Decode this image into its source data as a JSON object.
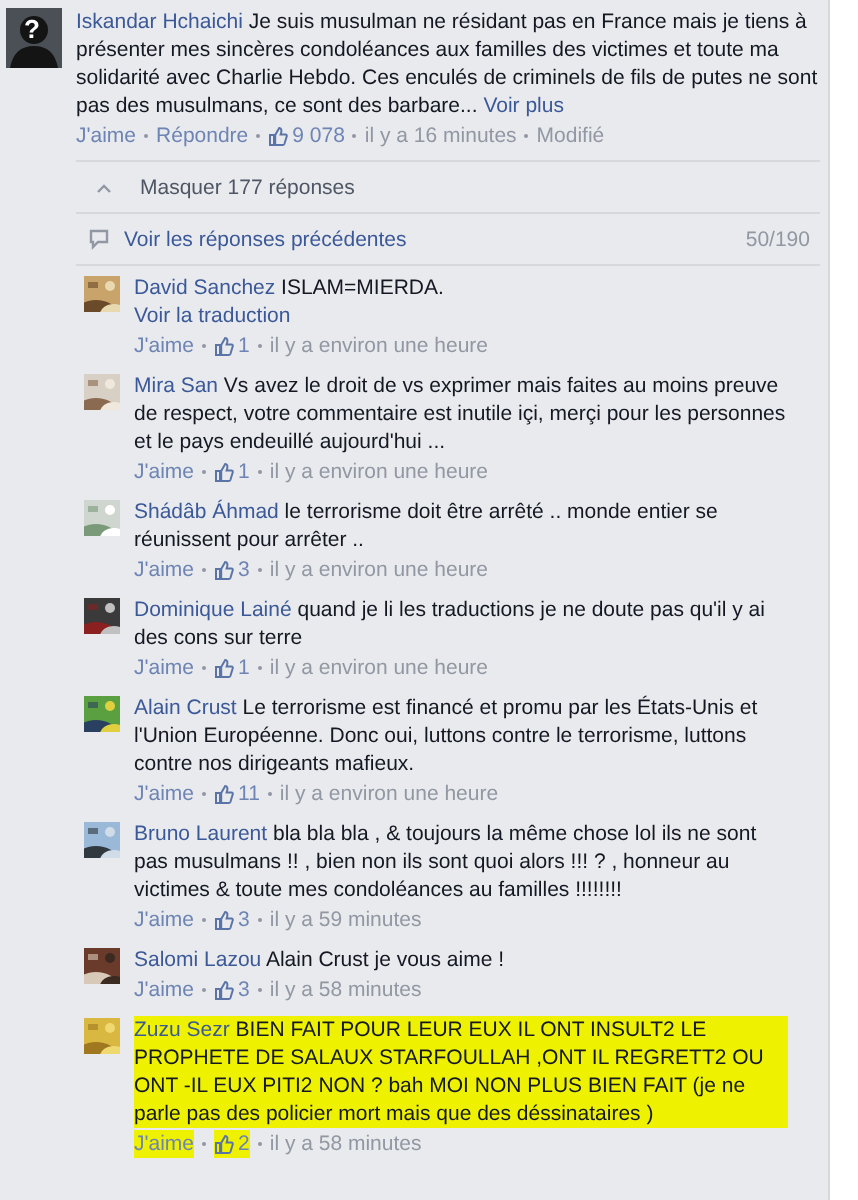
{
  "top_comment": {
    "avatar_glyph": "?",
    "author": "Iskandar Hchaichi",
    "text": "Je suis musulman ne résidant pas en France mais je tiens à présenter mes sincères condoléances aux familles des victimes et toute ma solidarité avec Charlie Hebdo. Ces enculés de criminels de fils de putes ne sont pas des musulmans, ce sont des barbare...",
    "more_link": "Voir plus",
    "like_label": "J'aime",
    "reply_label": "Répondre",
    "likes": "9 078",
    "time": "il y a 16 minutes",
    "edited_label": "Modifié"
  },
  "hide_replies": {
    "label": "Masquer 177 réponses",
    "expanded": true
  },
  "previous_replies": {
    "label": "Voir les réponses précédentes",
    "count": "50/190"
  },
  "replies": [
    {
      "author": "David Sanchez",
      "text": "ISLAM=MIERDA.",
      "translate_link": "Voir la traduction",
      "like_label": "J'aime",
      "likes": "1",
      "time": "il y a environ une heure",
      "highlighted": false
    },
    {
      "author": "Mira San",
      "text": "Vs avez le droit de vs exprimer mais faites au moins preuve de respect, votre commentaire est inutile içi, merçi pour les personnes et le pays endeuillé aujourd'hui ...",
      "like_label": "J'aime",
      "likes": "1",
      "time": "il y a environ une heure",
      "highlighted": false
    },
    {
      "author": "Shádâb Áhmad",
      "text": "le terrorisme doit être arrêté .. monde entier se réunissent pour arrêter ..",
      "like_label": "J'aime",
      "likes": "3",
      "time": "il y a environ une heure",
      "highlighted": false
    },
    {
      "author": "Dominique Lainé",
      "text": "quand je li les traductions je ne doute pas qu'il y ai des cons sur terre",
      "like_label": "J'aime",
      "likes": "1",
      "time": "il y a environ une heure",
      "highlighted": false
    },
    {
      "author": "Alain Crust",
      "text": "Le terrorisme est financé et promu par les États-Unis et l'Union Européenne. Donc oui, luttons contre le terrorisme, luttons contre nos dirigeants mafieux.",
      "like_label": "J'aime",
      "likes": "11",
      "time": "il y a environ une heure",
      "highlighted": false
    },
    {
      "author": "Bruno Laurent",
      "text": "bla bla bla , & toujours la même chose lol ils ne sont pas musulmans !! , bien non ils sont quoi alors !!! ? , honneur au victimes & toute mes condoléances au familles !!!!!!!!",
      "like_label": "J'aime",
      "likes": "3",
      "time": "il y a 59 minutes",
      "highlighted": false
    },
    {
      "author": "Salomi Lazou",
      "text": "Alain Crust je vous aime !",
      "like_label": "J'aime",
      "likes": "3",
      "time": "il y a 58 minutes",
      "highlighted": false
    },
    {
      "author": "Zuzu Sezr",
      "text": "BIEN FAIT POUR LEUR EUX IL ONT INSULT2 LE PROPHETE DE SALAUX STARFOULLAH ,ONT IL REGRETT2 OU ONT -IL EUX PITI2 NON ? bah MOI NON PLUS BIEN FAIT (je ne parle pas des policier mort mais que des déssinataires )",
      "like_label": "J'aime",
      "likes": "2",
      "time": "il y a 58 minutes",
      "highlighted": true
    }
  ]
}
